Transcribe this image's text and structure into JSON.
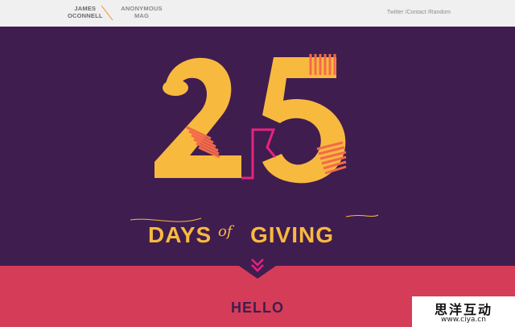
{
  "brand": {
    "line1": "JAMES",
    "line2": "OCONNELL",
    "name2_line1": "ANONYMOUS",
    "name2_line2": "MAG"
  },
  "nav": {
    "items": [
      "Twitter",
      "/Contact",
      "/Random"
    ]
  },
  "hero": {
    "number": "25",
    "days": "DAYS",
    "of": "of",
    "giving": "GIVING"
  },
  "section": {
    "title": "HELLO"
  },
  "watermark": {
    "chinese": "思洋互动",
    "url": "www.ciya.cn"
  },
  "colors": {
    "purple": "#3f1d4f",
    "yellow": "#f8b93f",
    "red": "#d53c58",
    "pink": "#e8227e",
    "coil": "#f36a4a"
  }
}
